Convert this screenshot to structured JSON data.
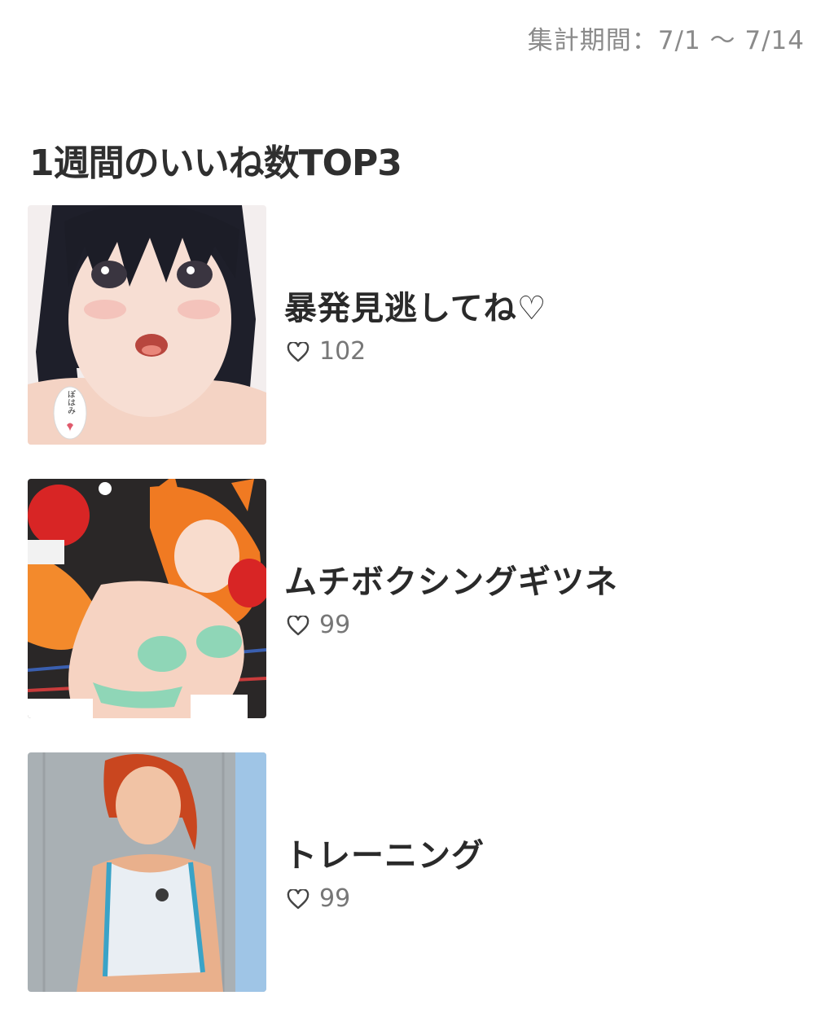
{
  "period": {
    "label": "集計期間：7/1 〜 7/14"
  },
  "section": {
    "title": "1週間のいいね数TOP3"
  },
  "ranking": [
    {
      "title": "暴発見逃してね♡",
      "likes": "102",
      "thumb_caption": "ぽはみ",
      "thumb_icon": "anime-girl-black-hair-thumbnail"
    },
    {
      "title": "ムチボクシングギツネ",
      "likes": "99",
      "thumb_icon": "anime-fox-girl-boxing-thumbnail"
    },
    {
      "title": "トレーニング",
      "likes": "99",
      "thumb_icon": "anime-red-hair-girl-training-thumbnail"
    }
  ]
}
